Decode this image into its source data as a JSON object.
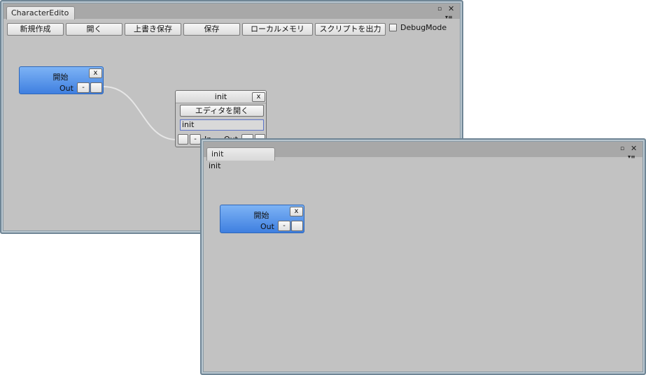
{
  "editor": {
    "tab_title": "CharacterEdito",
    "toolbar": {
      "new": "新規作成",
      "open": "開く",
      "overwrite_save": "上書き保存",
      "save": "保存",
      "local_memory": "ローカルメモリ",
      "export_script": "スクリプトを出力",
      "debug_mode_label": "DebugMode",
      "debug_mode_checked": false
    },
    "start_node": {
      "title": "開始",
      "out_label": "Out",
      "close": "x",
      "minus": "-"
    },
    "init_node": {
      "title": "init",
      "close": "x",
      "open_editor": "エディタを開く",
      "name_value": "init",
      "in_label": "In",
      "out_label": "Out",
      "minus": "-"
    }
  },
  "sub_window": {
    "tab_title": "init",
    "label": "init",
    "start_node": {
      "title": "開始",
      "out_label": "Out",
      "close": "x",
      "minus": "-"
    }
  },
  "window_controls": {
    "maximize_glyph": "▫",
    "close_glyph": "✕",
    "menu_glyph": "▾≡"
  }
}
